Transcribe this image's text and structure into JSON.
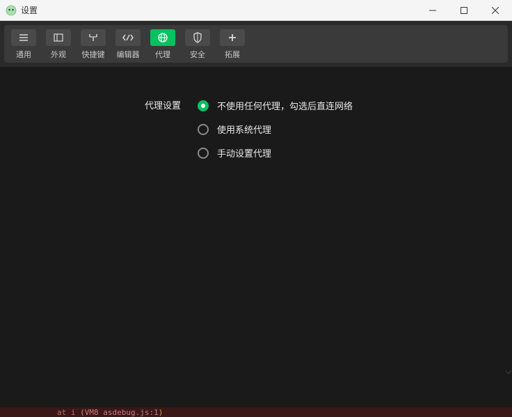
{
  "window": {
    "title": "设置"
  },
  "tabs": [
    {
      "label": "通用",
      "icon": "list-icon"
    },
    {
      "label": "外观",
      "icon": "layout-icon"
    },
    {
      "label": "快捷键",
      "icon": "keyboard-icon"
    },
    {
      "label": "编辑器",
      "icon": "code-icon"
    },
    {
      "label": "代理",
      "icon": "globe-icon",
      "active": true
    },
    {
      "label": "安全",
      "icon": "shield-icon"
    },
    {
      "label": "拓展",
      "icon": "plus-icon"
    }
  ],
  "proxy": {
    "section_label": "代理设置",
    "options": [
      {
        "label": "不使用任何代理，勾选后直连网络",
        "selected": true
      },
      {
        "label": "使用系统代理",
        "selected": false
      },
      {
        "label": "手动设置代理",
        "selected": false
      }
    ]
  },
  "footer": {
    "prefix": "at i ",
    "paren_open": "(",
    "vm": "VM8 asdebug.js:1",
    "paren_close": ")"
  }
}
